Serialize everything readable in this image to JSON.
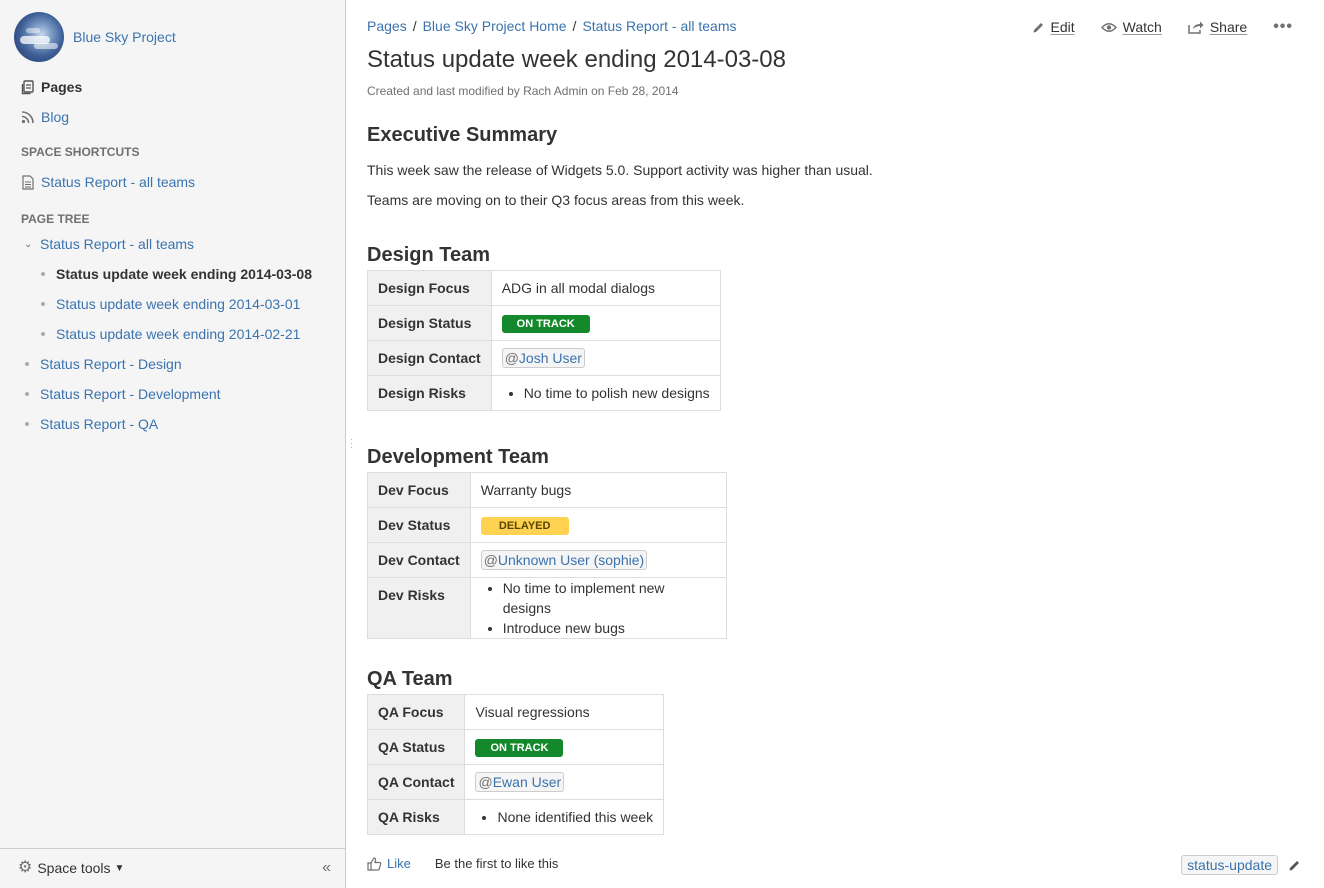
{
  "sidebar": {
    "space_name": "Blue Sky Project",
    "nav": {
      "pages": "Pages",
      "blog": "Blog"
    },
    "shortcuts_title": "SPACE SHORTCUTS",
    "shortcuts": [
      "Status Report - all teams"
    ],
    "tree_title": "PAGE TREE",
    "tree": {
      "root": "Status Report - all teams",
      "children": [
        "Status update week ending 2014-03-08",
        "Status update week ending 2014-03-01",
        "Status update week ending 2014-02-21"
      ],
      "siblings": [
        "Status Report - Design",
        "Status Report - Development",
        "Status Report - QA"
      ]
    },
    "footer": {
      "space_tools": "Space tools",
      "collapse": "«"
    }
  },
  "breadcrumbs": [
    "Pages",
    "Blue Sky Project Home",
    "Status Report - all teams"
  ],
  "breadcrumb_sep": "/",
  "actions": {
    "edit": "Edit",
    "watch": "Watch",
    "share": "Share",
    "more": "•••"
  },
  "page": {
    "title": "Status update week ending 2014-03-08",
    "meta": "Created and last modified by Rach Admin on Feb 28, 2014"
  },
  "summary": {
    "heading": "Executive Summary",
    "para1": "This week saw the release of Widgets 5.0.  Support activity was higher than usual.",
    "para2": "Teams are moving on to their Q3 focus areas from this week."
  },
  "design": {
    "heading": "Design Team",
    "focus_label": "Design Focus",
    "focus": "ADG in all modal dialogs",
    "status_label": "Design Status",
    "status": "ON TRACK",
    "contact_label": "Design Contact",
    "contact_at": "@",
    "contact": "Josh User",
    "risks_label": "Design Risks",
    "risks": [
      "No time to polish new designs"
    ]
  },
  "dev": {
    "heading": "Development Team",
    "focus_label": "Dev Focus",
    "focus": "Warranty bugs",
    "status_label": "Dev Status",
    "status": "DELAYED",
    "contact_label": "Dev Contact",
    "contact_at": "@",
    "contact": "Unknown User (sophie)",
    "risks_label": "Dev Risks",
    "risks": [
      "No time to implement new designs",
      "Introduce new bugs"
    ]
  },
  "qa": {
    "heading": "QA Team",
    "focus_label": "QA Focus",
    "focus": "Visual regressions",
    "status_label": "QA Status",
    "status": "ON TRACK",
    "contact_label": "QA Contact",
    "contact_at": "@",
    "contact": "Ewan User",
    "risks_label": "QA Risks",
    "risks": [
      "None identified this week"
    ]
  },
  "footer": {
    "like": "Like",
    "like_text": "Be the first to like this",
    "label": "status-update"
  },
  "colors": {
    "link": "#3b73af",
    "on_track": "#14892c",
    "delayed": "#ffd351",
    "sidebar_bg": "#f5f5f5"
  },
  "icons": {
    "pages": "pages-icon",
    "blog": "rss-icon",
    "shortcut": "page-icon",
    "edit": "pencil-icon",
    "watch": "eye-icon",
    "share": "share-icon",
    "like": "thumbs-up-icon",
    "tools": "gear-icon"
  }
}
